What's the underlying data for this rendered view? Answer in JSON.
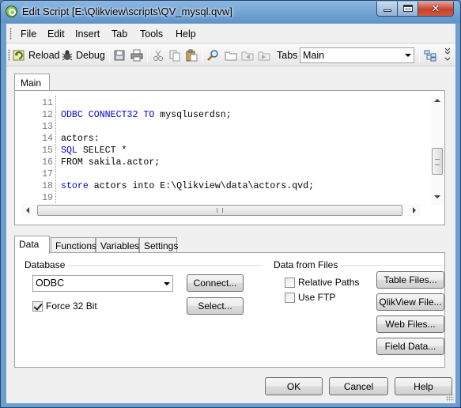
{
  "window": {
    "title": "Edit Script [E:\\Qlikview\\scripts\\QV_mysql.qvw]",
    "accent": "#6a9fd0",
    "close_color": "#c7422a"
  },
  "menu": [
    "File",
    "Edit",
    "Insert",
    "Tab",
    "Tools",
    "Help"
  ],
  "toolbar": {
    "reload_label": "Reload",
    "debug_label": "Debug",
    "tabs_label": "Tabs",
    "tab_selected": "Main"
  },
  "script_tabs": [
    "Main"
  ],
  "editor": {
    "lines": [
      {
        "num": "11",
        "text": ""
      },
      {
        "num": "12",
        "kw": "ODBC CONNECT32 TO",
        "text": " mysqluserdsn;"
      },
      {
        "num": "13",
        "text": ""
      },
      {
        "num": "14",
        "text": "actors:"
      },
      {
        "num": "15",
        "kw": "SQL",
        "text": " SELECT *"
      },
      {
        "num": "16",
        "text": "FROM sakila.actor;"
      },
      {
        "num": "17",
        "text": ""
      },
      {
        "num": "18",
        "kw": "store",
        "text": " actors into E:\\Qlikview\\data\\actors.qvd;"
      },
      {
        "num": "19",
        "text": ""
      }
    ],
    "keyword_color": "#0000d8"
  },
  "panel": {
    "tabs": [
      "Data",
      "Functions",
      "Variables",
      "Settings"
    ],
    "database_label": "Database",
    "database_value": "ODBC",
    "connect_label": "Connect...",
    "select_label": "Select...",
    "force32_label": "Force 32 Bit",
    "force32_checked": true,
    "files_label": "Data from Files",
    "relative_paths_label": "Relative Paths",
    "use_ftp_label": "Use FTP",
    "table_files_label": "Table Files...",
    "qlikview_file_label": "QlikView File...",
    "web_files_label": "Web Files...",
    "field_data_label": "Field Data..."
  },
  "dialog": {
    "ok_label": "OK",
    "cancel_label": "Cancel",
    "help_label": "Help"
  }
}
